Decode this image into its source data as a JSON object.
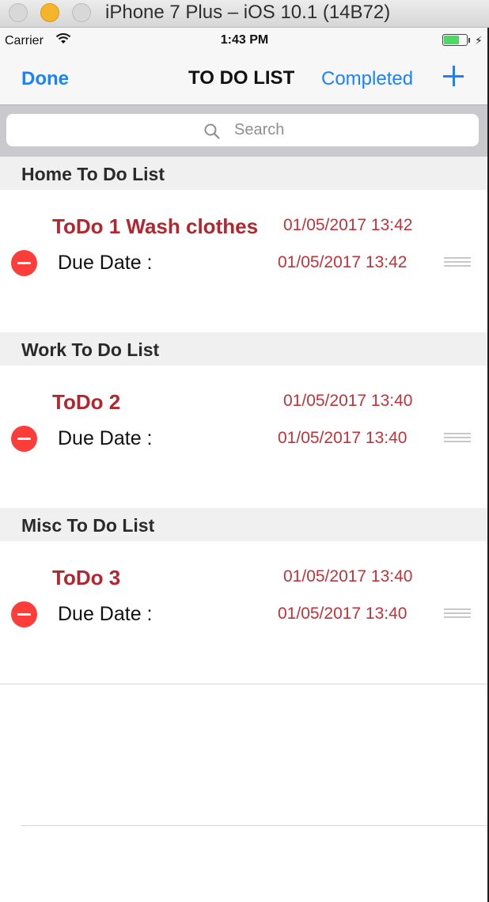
{
  "window": {
    "title": "iPhone 7 Plus – iOS 10.1 (14B72)"
  },
  "status_bar": {
    "carrier": "Carrier",
    "time": "1:43 PM",
    "battery_icon": "battery-charging-icon"
  },
  "nav": {
    "done_label": "Done",
    "title": "TO DO LIST",
    "completed_label": "Completed",
    "add_icon": "plus-icon"
  },
  "search": {
    "placeholder": "Search"
  },
  "sections": [
    {
      "title": "Home To Do List",
      "item": {
        "title": "ToDo 1 Wash clothes",
        "created": "01/05/2017 13:42",
        "due_label": "Due Date :",
        "due": "01/05/2017 13:42"
      }
    },
    {
      "title": "Work To Do List",
      "item": {
        "title": "ToDo 2",
        "created": "01/05/2017 13:40",
        "due_label": "Due Date :",
        "due": "01/05/2017 13:40"
      }
    },
    {
      "title": "Misc To Do List",
      "item": {
        "title": "ToDo 3",
        "created": "01/05/2017 13:40",
        "due_label": "Due Date :",
        "due": "01/05/2017 13:40"
      }
    }
  ],
  "colors": {
    "accent": "#1a82fb",
    "todo_red": "#b3262e",
    "delete_red": "#fc3d39"
  }
}
